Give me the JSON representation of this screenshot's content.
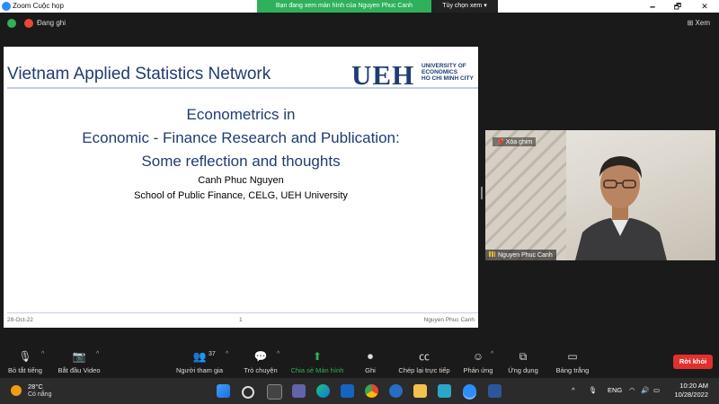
{
  "window": {
    "title": "Zoom Cuộc họp",
    "share_banner": "Bạn đang xem màn hình của Nguyen Phuc Canh",
    "view_options": "Tùy chọn xem",
    "minimize": "🗕",
    "restore": "🗗",
    "close": "✕"
  },
  "status": {
    "recording_label": "Đang ghi",
    "view_button": "Xem"
  },
  "slide": {
    "network": "Vietnam Applied Statistics Network",
    "logo_text": "UEH",
    "logo_sub": [
      "UNIVERSITY OF",
      "ECONOMICS",
      "HO CHI MINH CITY"
    ],
    "title_line1": "Econometrics in",
    "title_line2": "Economic - Finance Research and Publication:",
    "title_line3": "Some reflection and thoughts",
    "author": "Canh Phuc Nguyen",
    "institution": "School of Public Finance, CELG, UEH University",
    "footer_date": "28-Oct-22",
    "footer_page": "1",
    "footer_name": "Nguyen Phuc Canh"
  },
  "video": {
    "pin_label": "Xóa ghim",
    "name_label": "Nguyen Phuc Canh"
  },
  "toolbar": {
    "mute": "Bỏ tắt tiếng",
    "start_video": "Bắt đầu Video",
    "participants": "Người tham gia",
    "participants_count": "37",
    "chat": "Trò chuyện",
    "share": "Chia sẻ Màn hình",
    "record": "Ghi",
    "captions": "Chép lại trực tiếp",
    "reactions": "Phản ứng",
    "apps": "Ứng dụng",
    "whiteboard": "Bảng trắng",
    "leave": "Rời khỏi"
  },
  "taskbar": {
    "temperature": "28°C",
    "condition": "Có nắng",
    "language": "ENG",
    "time": "10:20 AM",
    "date": "10/28/2022"
  },
  "colors": {
    "share_green": "#2fb05a",
    "leave_red": "#e0312f",
    "slide_blue": "#1f3c73"
  }
}
